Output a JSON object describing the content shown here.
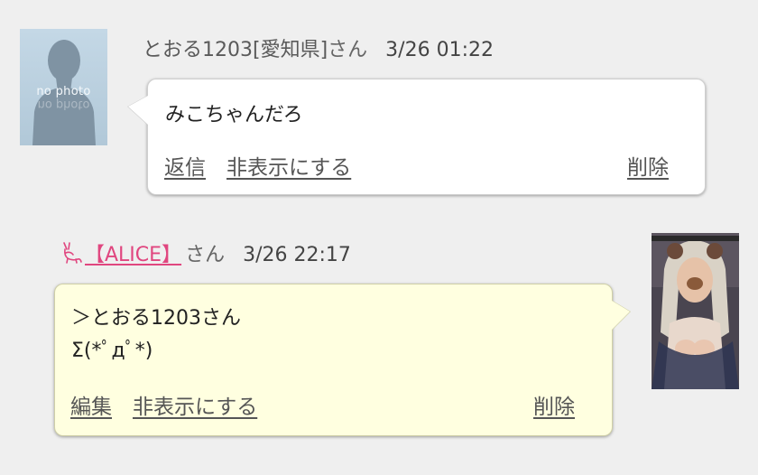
{
  "comments": [
    {
      "author": "とおる1203[愛知県]",
      "honorific": "さん",
      "datetime": "3/26 01:22",
      "avatar_label": "no photo",
      "message_lines": [
        "みこちゃんだろ"
      ],
      "actions": {
        "first": "返信",
        "hide": "非表示にする",
        "delete": "削除"
      },
      "bubble_color": "#ffffff"
    },
    {
      "author": "【ALICE】",
      "honorific": "さん",
      "datetime": "3/26 22:17",
      "author_color": "#e0467f",
      "author_icon": "cat-icon",
      "message_lines": [
        "＞とおる1203さん",
        "Σ(*ﾟдﾟ*)"
      ],
      "actions": {
        "first": "編集",
        "hide": "非表示にする",
        "delete": "削除"
      },
      "bubble_color": "#ffffe0"
    }
  ]
}
